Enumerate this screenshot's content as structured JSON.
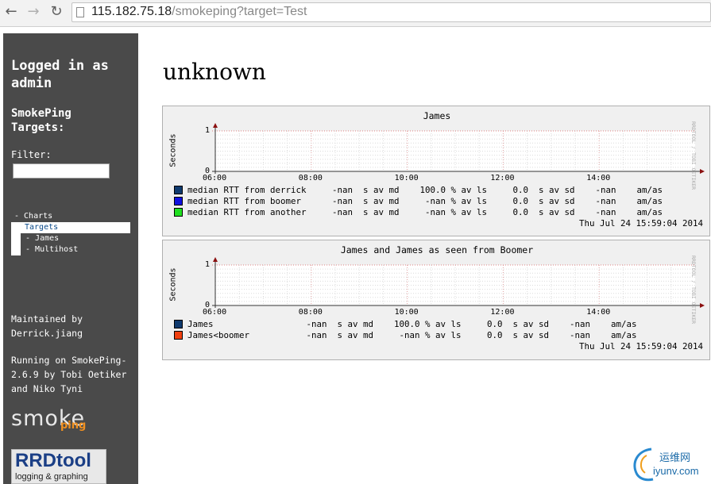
{
  "browser": {
    "url_host": "115.182.75.18",
    "url_path": "/smokeping?target=Test",
    "back_icon": "arrow-left-icon",
    "forward_icon": "arrow-right-icon",
    "reload_icon": "reload-icon"
  },
  "sidebar": {
    "login_line1": "Logged in as",
    "login_line2": "admin",
    "targets_line1": "SmokePing",
    "targets_line2": "Targets:",
    "filter_label": "Filter:",
    "filter_value": "",
    "menu": [
      {
        "label": "- Charts",
        "style": "plain"
      },
      {
        "label": "Targets",
        "style": "selected"
      },
      {
        "label": " - James",
        "style": "sub"
      },
      {
        "label": " - Multihost",
        "style": "sub"
      }
    ],
    "maintained_1": "Maintained by",
    "maintained_2": "Derrick.jiang",
    "running_1": "Running on SmokePing-",
    "running_2": "2.6.9 by Tobi Oetiker",
    "running_3": "and Niko Tyni",
    "smoke_logo_word": "smoke",
    "smoke_logo_sub": "ping",
    "rrd_logo_word": "RRDtool",
    "rrd_logo_sub": "logging & graphing"
  },
  "main": {
    "title": "unknown",
    "graphs": [
      {
        "title": "James",
        "ylabel": "Seconds",
        "vendor": "RRDTOOL / TOBI OETIKER",
        "xticks": [
          "06:00",
          "08:00",
          "10:00",
          "12:00",
          "14:00"
        ],
        "yticks": [
          "1",
          "0"
        ],
        "legend": [
          {
            "color": "#0f3a6e",
            "text": "median RTT from derrick     -nan  s av md    100.0 % av ls     0.0  s av sd    -nan    am/as"
          },
          {
            "color": "#1010e0",
            "text": "median RTT from boomer      -nan  s av md     -nan % av ls     0.0  s av sd    -nan    am/as"
          },
          {
            "color": "#20e020",
            "text": "median RTT from another     -nan  s av md     -nan % av ls     0.0  s av sd    -nan    am/as"
          }
        ],
        "timestamp": "Thu Jul 24 15:59:04 2014"
      },
      {
        "title": "James and James as seen from Boomer",
        "ylabel": "Seconds",
        "vendor": "RRDTOOL / TOBI OETIKER",
        "xticks": [
          "06:00",
          "08:00",
          "10:00",
          "12:00",
          "14:00"
        ],
        "yticks": [
          "1",
          "0"
        ],
        "legend": [
          {
            "color": "#0f3a6e",
            "text": "James                  -nan  s av md    100.0 % av ls     0.0  s av sd    -nan    am/as"
          },
          {
            "color": "#f04010",
            "text": "James<boomer           -nan  s av md     -nan % av ls     0.0  s av sd    -nan    am/as"
          }
        ],
        "timestamp": "Thu Jul 24 15:59:04 2014"
      }
    ]
  },
  "watermark": {
    "cn": "运维网",
    "en": "iyunv.com"
  }
}
